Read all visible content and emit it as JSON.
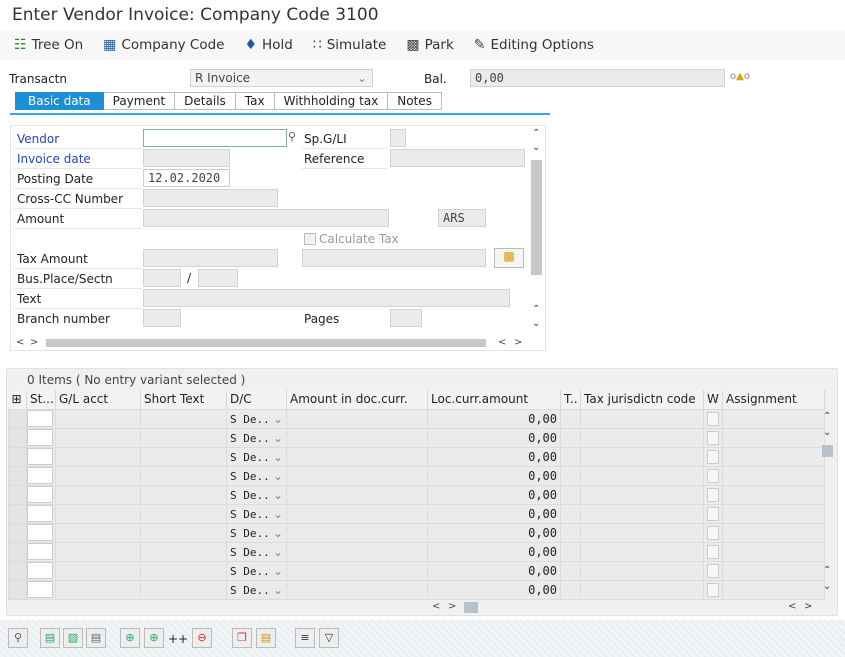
{
  "title": "Enter Vendor Invoice: Company Code 3100",
  "toolbar": [
    {
      "label": "Tree On",
      "icon": "tree-icon"
    },
    {
      "label": "Company Code",
      "icon": "building-icon"
    },
    {
      "label": "Hold",
      "icon": "hold-icon"
    },
    {
      "label": "Simulate",
      "icon": "simulate-icon"
    },
    {
      "label": "Park",
      "icon": "save-icon"
    },
    {
      "label": "Editing Options",
      "icon": "pencil-icon"
    }
  ],
  "header": {
    "transactn_label": "Transactn",
    "transactn_value": "R Invoice",
    "bal_label": "Bal.",
    "bal_value": "0,00"
  },
  "tabs": [
    "Basic data",
    "Payment",
    "Details",
    "Tax",
    "Withholding tax",
    "Notes"
  ],
  "form": {
    "vendor": "Vendor",
    "spgl": "Sp.G/LI",
    "invoice_date": "Invoice date",
    "reference": "Reference",
    "posting_date": "Posting Date",
    "posting_date_value": "12.02.2020",
    "cross_cc": "Cross-CC Number",
    "amount": "Amount",
    "currency": "ARS",
    "calc_tax": "Calculate Tax",
    "tax_amount": "Tax Amount",
    "bus_place": "Bus.Place/Sectn",
    "slash": "/",
    "text": "Text",
    "branch": "Branch number",
    "pages": "Pages"
  },
  "items": {
    "summary": "0 Items ( No entry variant selected )",
    "columns": [
      "St...",
      "G/L acct",
      "Short Text",
      "D/C",
      "Amount in doc.curr.",
      "Loc.curr.amount",
      "T..",
      "Tax jurisdictn code",
      "W",
      "Assignment"
    ],
    "rows": [
      {
        "dc": "S De..",
        "loc": "0,00"
      },
      {
        "dc": "S De..",
        "loc": "0,00"
      },
      {
        "dc": "S De..",
        "loc": "0,00"
      },
      {
        "dc": "S De..",
        "loc": "0,00"
      },
      {
        "dc": "S De..",
        "loc": "0,00"
      },
      {
        "dc": "S De..",
        "loc": "0,00"
      },
      {
        "dc": "S De..",
        "loc": "0,00"
      },
      {
        "dc": "S De..",
        "loc": "0,00"
      },
      {
        "dc": "S De..",
        "loc": "0,00"
      },
      {
        "dc": "S De..",
        "loc": "0,00"
      }
    ]
  },
  "bottom_buttons": [
    "++"
  ]
}
